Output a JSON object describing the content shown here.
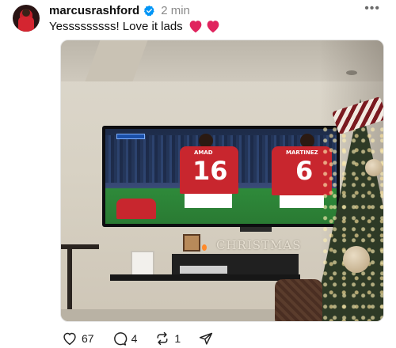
{
  "post": {
    "author": {
      "username": "marcusrashford",
      "verified": true,
      "avatar_icon": "avatar"
    },
    "timestamp": "2 min",
    "menu_icon": "more-horizontal-icon",
    "text": "Yesssssssss! Love it lads",
    "emoji": [
      "red-heart-icon",
      "red-heart-icon"
    ],
    "image": {
      "tv_sign": "CHRISTMAS",
      "jersey_numbers": [
        "16",
        "6"
      ],
      "jersey_names": [
        "AMAD",
        "MARTINEZ"
      ]
    },
    "actions": {
      "likes": "67",
      "replies": "4",
      "reposts": "1"
    }
  },
  "colors": {
    "verified": "#0095f6",
    "heart": "#e0245e",
    "text": "#101010",
    "muted": "#8a8a8a",
    "jersey_red": "#c8262e"
  }
}
